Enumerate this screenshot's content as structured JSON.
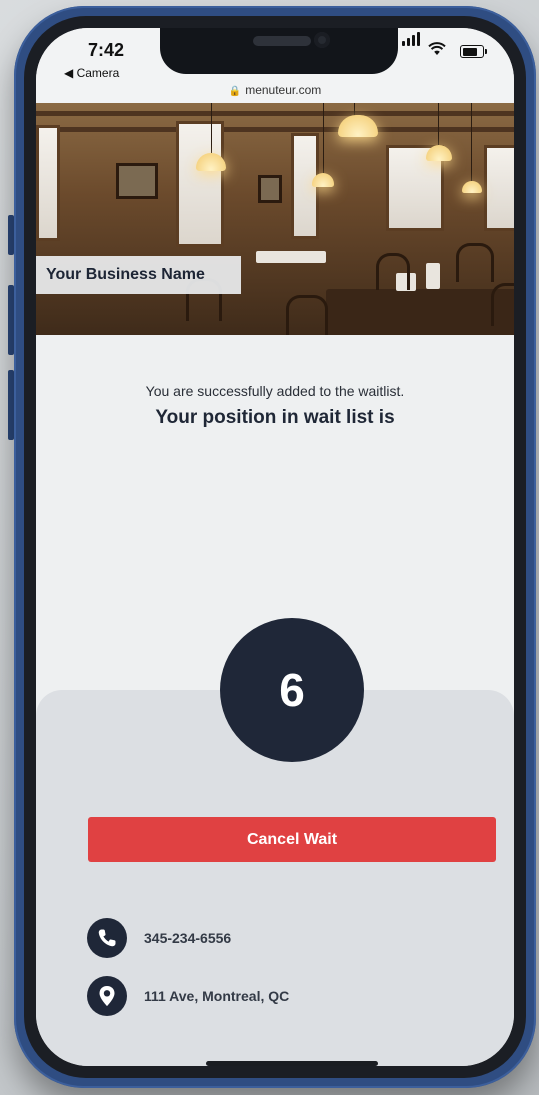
{
  "status_bar": {
    "time": "7:42",
    "back_app": "◀ Camera",
    "url": "menuteur.com"
  },
  "hero": {
    "business_name": "Your Business Name"
  },
  "waitlist": {
    "confirmation": "You are successfully added to the waitlist.",
    "position_label": "Your position in wait list is",
    "position": "6"
  },
  "actions": {
    "cancel_label": "Cancel Wait"
  },
  "contact": {
    "phone": "345-234-6556",
    "address": "111 Ave, Montreal, QC",
    "phone_icon": "phone-icon",
    "location_icon": "location-pin-icon"
  },
  "colors": {
    "accent_red": "#e04142",
    "navy": "#1f2738",
    "frame_blue": "#2f4d82"
  }
}
